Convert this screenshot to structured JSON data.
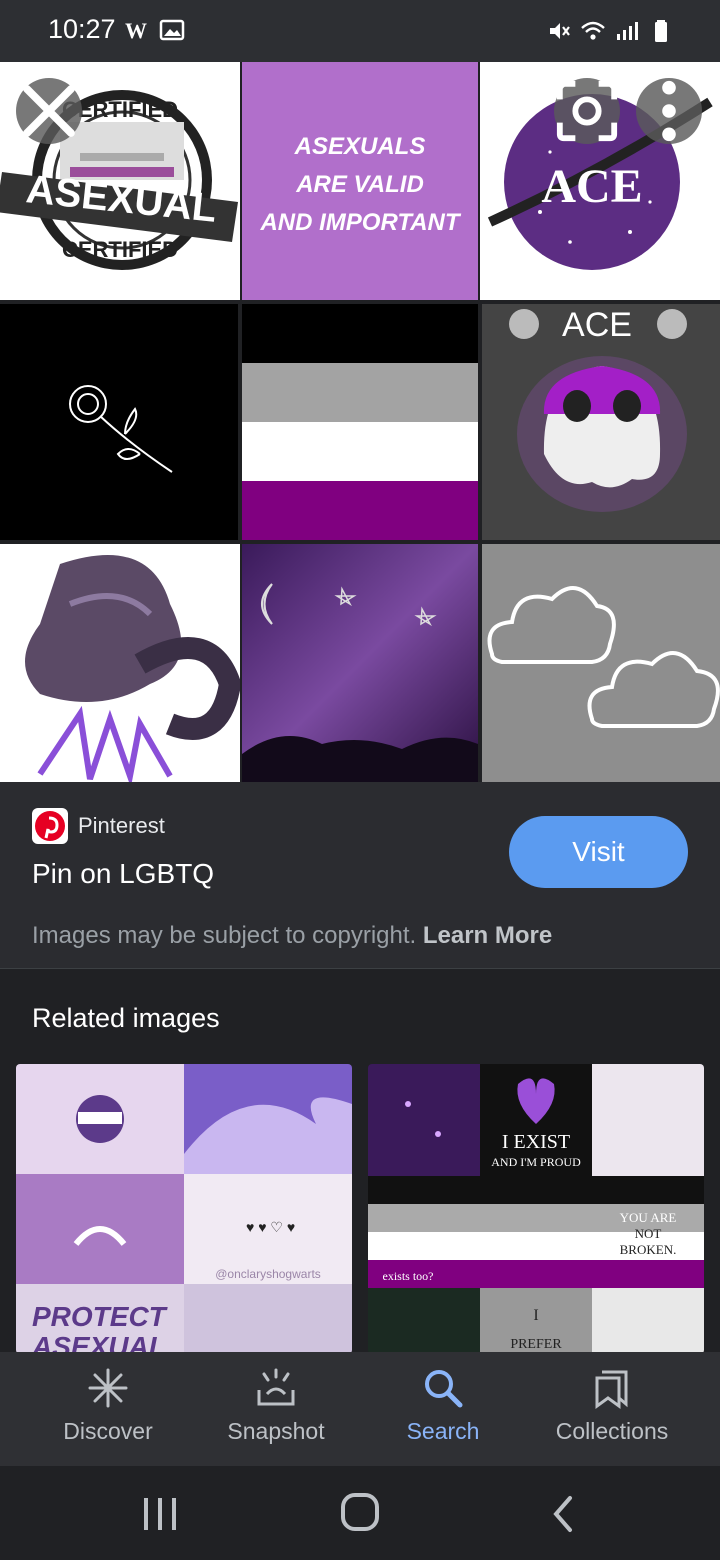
{
  "status": {
    "time": "10:27",
    "left_icons": [
      "w-icon",
      "image-icon"
    ],
    "right_icons": [
      "mute-icon",
      "wifi-icon",
      "signal-icon",
      "battery-icon"
    ]
  },
  "grid": {
    "tiles": [
      {
        "name": "asexual-certified-stamp",
        "text": [
          "CERTIFIED",
          "ASEXUAL",
          "CERTIFIED"
        ]
      },
      {
        "name": "asexuals-are-valid-text",
        "text": [
          "ASEXUALS",
          "ARE VALID",
          "AND IMPORTANT"
        ]
      },
      {
        "name": "ace-nasa-logo",
        "text": [
          "ACE"
        ]
      },
      {
        "name": "rose-drawing"
      },
      {
        "name": "ace-flag"
      },
      {
        "name": "ace-ghost",
        "text": [
          "ACE"
        ]
      },
      {
        "name": "dragon-drawing"
      },
      {
        "name": "purple-galaxy"
      },
      {
        "name": "neon-clouds"
      }
    ],
    "close_icon": "close-icon",
    "lens_icon": "lens-icon",
    "more_icon": "more-vert-icon"
  },
  "info": {
    "source": "Pinterest",
    "title": "Pin on LGBTQ",
    "visit_label": "Visit",
    "copyright_text": "Images may be subject to copyright. ",
    "learn_more": "Learn More"
  },
  "related": {
    "heading": "Related images",
    "left_texts": [
      "@onclaryshogwarts",
      "PROTECT",
      "ASEXUAL"
    ],
    "right_texts": [
      "I EXIST",
      "AND I'M PROUD",
      "YOU ARE",
      "NOT",
      "BROKEN.",
      "exists too?",
      "I",
      "PREFER"
    ]
  },
  "bottom_nav": [
    {
      "label": "Discover",
      "icon": "discover-icon"
    },
    {
      "label": "Snapshot",
      "icon": "snapshot-icon"
    },
    {
      "label": "Search",
      "icon": "search-icon"
    },
    {
      "label": "Collections",
      "icon": "collections-icon"
    }
  ],
  "colors": {
    "accent": "#8ab4f8",
    "visit_button": "#5b9bf0",
    "background": "#202124",
    "panel": "#2b2c30",
    "ace_purple": "#800080"
  }
}
